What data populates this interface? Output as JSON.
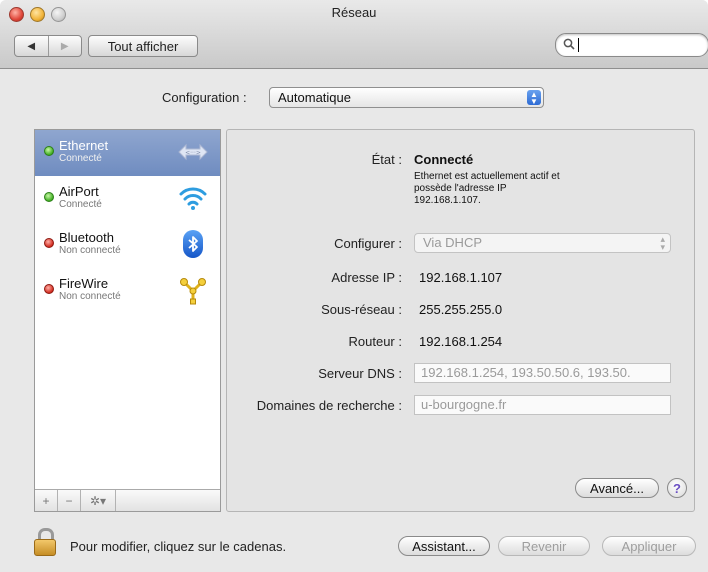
{
  "window": {
    "title": "Réseau"
  },
  "toolbar": {
    "back_glyph": "◀",
    "forward_glyph": "▶",
    "show_all_label": "Tout afficher",
    "search_icon": "magnifier-icon",
    "search_value": ""
  },
  "configuration": {
    "label": "Configuration :",
    "value": "Automatique"
  },
  "services": [
    {
      "name": "Ethernet",
      "status": "Connecté",
      "state": "connected",
      "icon": "ethernet-icon",
      "selected": true
    },
    {
      "name": "AirPort",
      "status": "Connecté",
      "state": "connected",
      "icon": "wifi-icon",
      "selected": false
    },
    {
      "name": "Bluetooth",
      "status": "Non connecté",
      "state": "disconnected",
      "icon": "bluetooth-icon",
      "selected": false
    },
    {
      "name": "FireWire",
      "status": "Non connecté",
      "state": "disconnected",
      "icon": "firewire-icon",
      "selected": false
    }
  ],
  "sidebar_buttons": {
    "add": "+",
    "remove": "−",
    "gear": "✲▾"
  },
  "detail": {
    "state_label": "État :",
    "state_value": "Connecté",
    "description_lines": [
      "Ethernet est actuellement actif et",
      "possède l'adresse IP",
      "192.168.1.107."
    ],
    "configure_label": "Configurer :",
    "configure_value": "Via DHCP",
    "ip_label": "Adresse IP :",
    "ip_value": "192.168.1.107",
    "subnet_label": "Sous-réseau :",
    "subnet_value": "255.255.255.0",
    "router_label": "Routeur :",
    "router_value": "192.168.1.254",
    "dns_label": "Serveur DNS :",
    "dns_value": "192.168.1.254, 193.50.50.6, 193.50.",
    "search_domains_label": "Domaines de recherche :",
    "search_domains_value": "u-bourgogne.fr",
    "advanced_button": "Avancé...",
    "help_glyph": "?"
  },
  "footer": {
    "lock_text": "Pour modifier, cliquez sur le cadenas.",
    "assistant_button": "Assistant...",
    "revert_button": "Revenir",
    "apply_button": "Appliquer"
  },
  "colors": {
    "selection": "#7d98c8",
    "connected": "#3fae22",
    "disconnected": "#d22a1e",
    "popup_arrows": "#3d7bdc"
  }
}
